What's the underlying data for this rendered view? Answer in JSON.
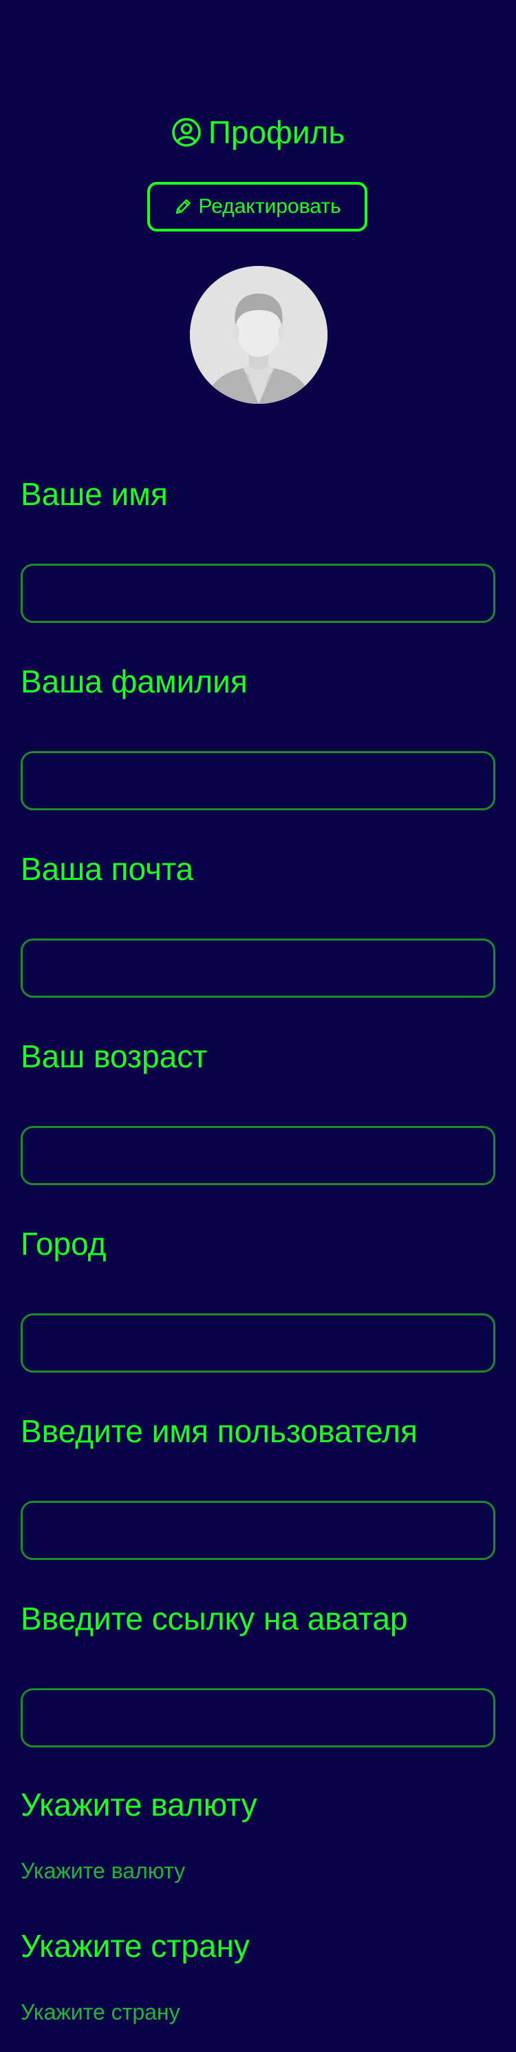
{
  "header": {
    "title": "Профиль",
    "icon": "user-circle-icon"
  },
  "edit_button": {
    "label": "Редактировать",
    "icon": "pencil-icon"
  },
  "avatar": {
    "icon": "default-avatar-placeholder"
  },
  "form": {
    "first_name": {
      "label": "Ваше имя",
      "value": ""
    },
    "last_name": {
      "label": "Ваша фамилия",
      "value": ""
    },
    "email": {
      "label": "Ваша почта",
      "value": ""
    },
    "age": {
      "label": "Ваш возраст",
      "value": ""
    },
    "city": {
      "label": "Город",
      "value": ""
    },
    "username": {
      "label": "Введите имя пользователя",
      "value": ""
    },
    "avatar_url": {
      "label": "Введите ссылку на аватар",
      "value": ""
    },
    "currency": {
      "label": "Укажите валюту",
      "placeholder": "Укажите валюту"
    },
    "country": {
      "label": "Укажите страну",
      "placeholder": "Укажите страну"
    }
  },
  "colors": {
    "background": "#090448",
    "accent": "#1eff1e",
    "input_border": "#1f8a2a",
    "muted_accent": "#23b535"
  }
}
